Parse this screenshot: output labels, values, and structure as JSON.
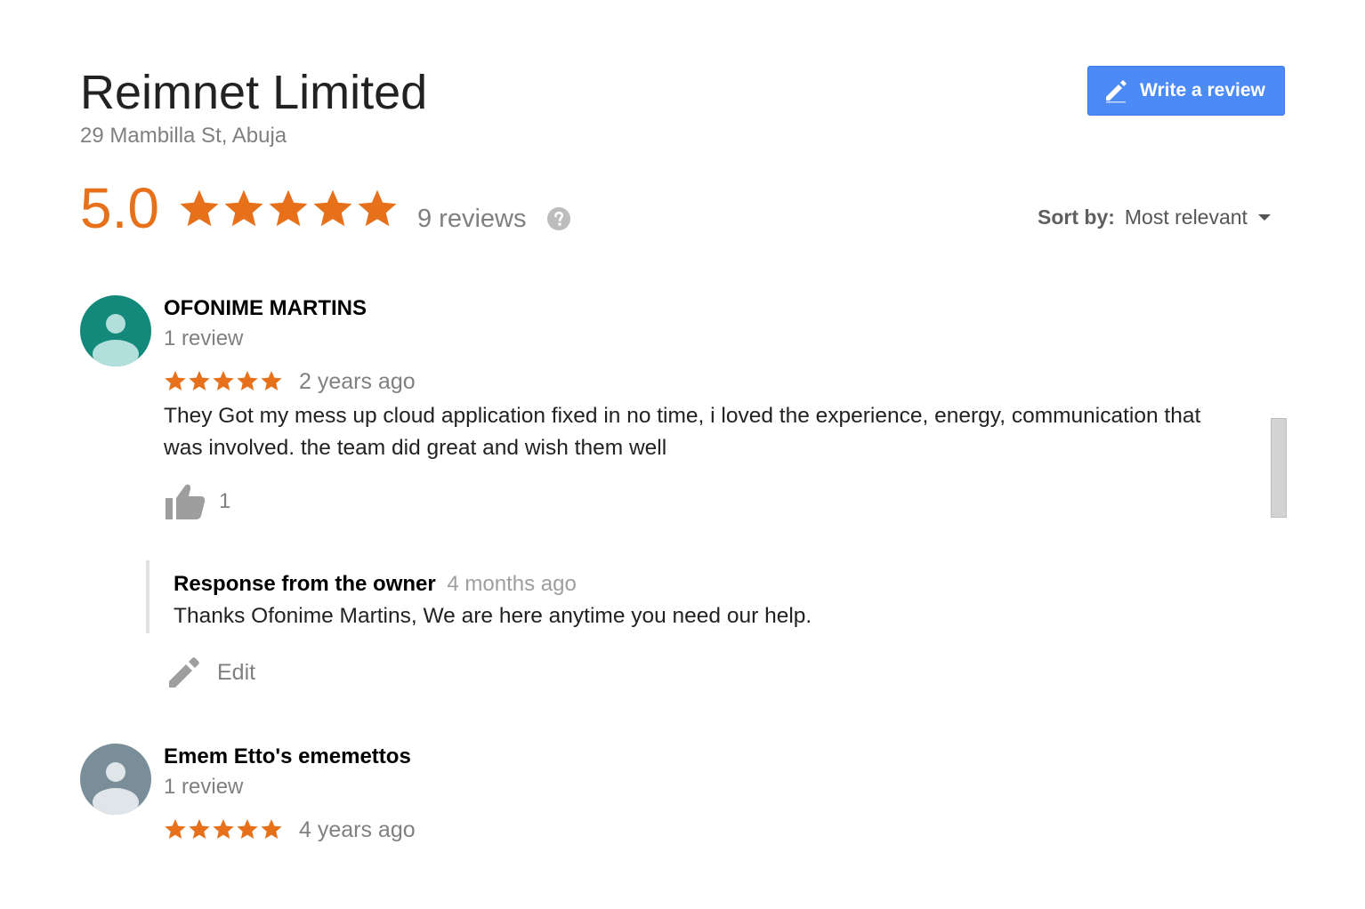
{
  "business": {
    "name": "Reimnet Limited",
    "address": "29 Mambilla St, Abuja"
  },
  "actions": {
    "write_review_label": "Write a review",
    "write_review_icon": "pencil-icon"
  },
  "summary": {
    "rating": "5.0",
    "stars": 5,
    "review_count": "9 reviews",
    "help_icon": "help-circle-icon"
  },
  "sort": {
    "label": "Sort by:",
    "value": "Most relevant",
    "icon": "dropdown-arrow-icon"
  },
  "colors": {
    "star": "#e7711b",
    "button": "#4c8bf5",
    "avatar1": "#12897a",
    "avatar2": "#7a8e99"
  },
  "reviews": [
    {
      "name": "OFONIME MARTINS",
      "meta": "1 review",
      "stars": 5,
      "time": "2 years ago",
      "text": "They Got my mess up cloud application fixed in no time, i loved the experience, energy, communication that was involved. the team did great and wish them well",
      "likes": "1",
      "owner_response": {
        "title": "Response from the owner",
        "time": "4 months ago",
        "text": "Thanks Ofonime Martins, We are here anytime you need our help."
      },
      "edit_label": "Edit"
    },
    {
      "name": "Emem Etto's ememettos",
      "meta": "1 review",
      "stars": 5,
      "time": "4 years ago"
    }
  ]
}
